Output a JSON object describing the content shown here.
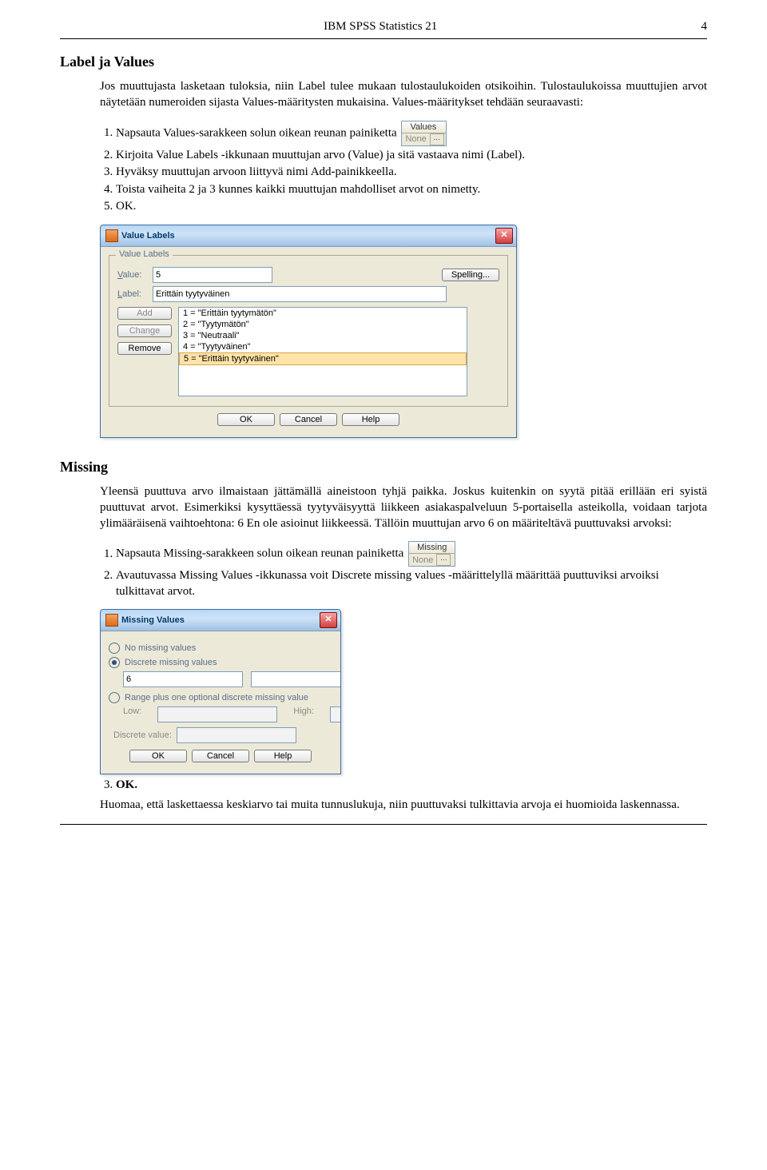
{
  "header": {
    "title": "IBM SPSS Statistics 21",
    "page": "4"
  },
  "section1": {
    "heading": "Label ja Values",
    "intro": "Jos muuttujasta lasketaan tuloksia, niin Label tulee mukaan tulostaulukoiden otsikoihin. Tulostaulukoissa muuttujien arvot näytetään numeroiden sijasta Values-määritysten mukaisina. Values-määritykset tehdään seuraavasti:",
    "steps": [
      "Napsauta Values-sarakkeen solun oikean reunan painiketta",
      "Kirjoita Value Labels -ikkunaan muuttujan arvo (Value) ja sitä vastaava nimi (Label).",
      "Hyväksy muuttujan arvoon liittyvä nimi Add-painikkeella.",
      "Toista vaiheita 2 ja 3 kunnes kaikki muuttujan mahdolliset arvot on nimetty.",
      "OK."
    ],
    "cell": {
      "header": "Values",
      "value": "None"
    }
  },
  "vldialog": {
    "title": "Value Labels",
    "group": "Value Labels",
    "valueLabel": "Value:",
    "labelLabel": "Label:",
    "valueVal": "5",
    "labelVal": "Erittäin tyytyväinen",
    "spelling": "Spelling...",
    "add": "Add",
    "change": "Change",
    "remove": "Remove",
    "items": [
      "1 = \"Erittäin tyytymätön\"",
      "2 = \"Tyytymätön\"",
      "3 = \"Neutraali\"",
      "4 = \"Tyytyväinen\"",
      "5 = \"Erittäin tyytyväinen\""
    ],
    "ok": "OK",
    "cancel": "Cancel",
    "help": "Help"
  },
  "section2": {
    "heading": "Missing",
    "intro": "Yleensä puuttuva arvo ilmaistaan jättämällä aineistoon tyhjä paikka. Joskus kuitenkin on syytä pitää erillään eri syistä puuttuvat arvot. Esimerkiksi kysyttäessä tyytyväisyyttä liikkeen asiakaspalveluun 5-portaisella asteikolla, voidaan tarjota ylimääräisenä vaihtoehtona: 6 En ole asioinut liikkeessä. Tällöin muuttujan arvo 6 on määriteltävä puuttuvaksi arvoksi:",
    "steps": [
      "Napsauta Missing-sarakkeen solun oikean reunan painiketta",
      "Avautuvassa Missing Values -ikkunassa voit Discrete missing values -määrittelyllä määrittää puuttuviksi arvoiksi tulkittavat arvot."
    ],
    "cell": {
      "header": "Missing",
      "value": "None"
    }
  },
  "mvdialog": {
    "title": "Missing Values",
    "r1": "No missing values",
    "r2": "Discrete missing values",
    "v1": "6",
    "r3": "Range plus one optional discrete missing value",
    "low": "Low:",
    "high": "High:",
    "dv": "Discrete value:",
    "ok": "OK",
    "cancel": "Cancel",
    "help": "Help"
  },
  "after": {
    "step3": "OK.",
    "note": "Huomaa, että laskettaessa keskiarvo tai muita tunnuslukuja, niin puuttuvaksi tulkittavia arvoja ei huomioida laskennassa."
  }
}
